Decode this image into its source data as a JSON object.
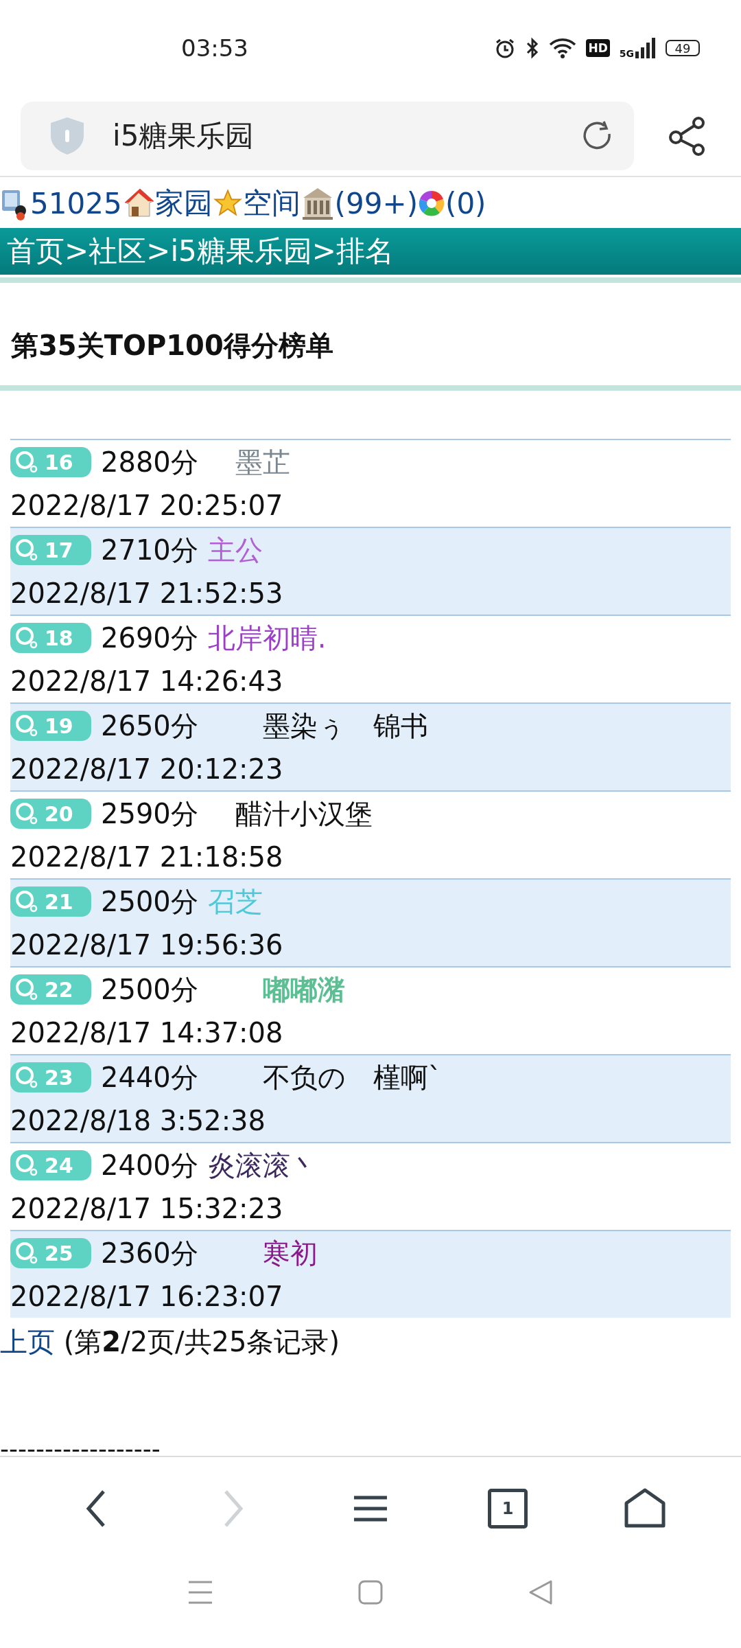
{
  "status_bar": {
    "time": "03:53",
    "battery": "49",
    "network": "5G",
    "quality": "HD"
  },
  "address_bar": {
    "title": "i5糖果乐园"
  },
  "user_bar": [
    {
      "kind": "user",
      "label": "51025"
    },
    {
      "kind": "home",
      "label": "家园"
    },
    {
      "kind": "star",
      "label": "空间"
    },
    {
      "kind": "building",
      "label": "(99+)"
    },
    {
      "kind": "wheel",
      "label": "(0)"
    }
  ],
  "breadcrumb": "首页>社区>i5糖果乐园>排名",
  "heading": "第35关TOP100得分榜单",
  "entries": [
    {
      "rank": "16",
      "score": "2880分",
      "name": "　墨芷",
      "color": "#7b8790",
      "bold": false,
      "time": "2022/8/17 20:25:07"
    },
    {
      "rank": "17",
      "score": "2710分",
      "name": "主公",
      "color": "#b25fd6",
      "bold": false,
      "time": "2022/8/17 21:52:53"
    },
    {
      "rank": "18",
      "score": "2690分",
      "name": "北岸初晴.",
      "color": "#9b3fc9",
      "bold": false,
      "time": "2022/8/17 14:26:43"
    },
    {
      "rank": "19",
      "score": "2650分",
      "name": "　　墨染ぅ　锦书",
      "color": "#111111",
      "bold": false,
      "time": "2022/8/17 20:12:23"
    },
    {
      "rank": "20",
      "score": "2590分",
      "name": "　醋汁小汉堡",
      "color": "#111111",
      "bold": false,
      "time": "2022/8/17 21:18:58"
    },
    {
      "rank": "21",
      "score": "2500分",
      "name": "召芝",
      "color": "#4fc8d8",
      "bold": false,
      "time": "2022/8/17 19:56:36"
    },
    {
      "rank": "22",
      "score": "2500分",
      "name": "　　嘟嘟潴",
      "color": "#5cbf94",
      "bold": true,
      "time": "2022/8/17 14:37:08"
    },
    {
      "rank": "23",
      "score": "2440分",
      "name": "　　不负の　槿啊ˋ",
      "color": "#111111",
      "bold": false,
      "time": "2022/8/18 3:52:38"
    },
    {
      "rank": "24",
      "score": "2400分",
      "name": "炎滚滚丶",
      "color": "#3c2a5e",
      "bold": false,
      "time": "2022/8/17 15:32:23"
    },
    {
      "rank": "25",
      "score": "2360分",
      "name": "　　寒初",
      "color": "#8a1a8a",
      "bold": false,
      "time": "2022/8/17 16:23:07"
    }
  ],
  "pager": {
    "link": "上页",
    "info": "(第**2**/2页/共25条记录)"
  },
  "divider_text": "------------------",
  "browser_toolbar": [
    {
      "kind": "back",
      "disabled": false
    },
    {
      "kind": "forward",
      "disabled": true
    },
    {
      "kind": "menu",
      "disabled": false
    },
    {
      "kind": "tabs",
      "label": "1",
      "disabled": false
    },
    {
      "kind": "home",
      "disabled": false
    }
  ]
}
